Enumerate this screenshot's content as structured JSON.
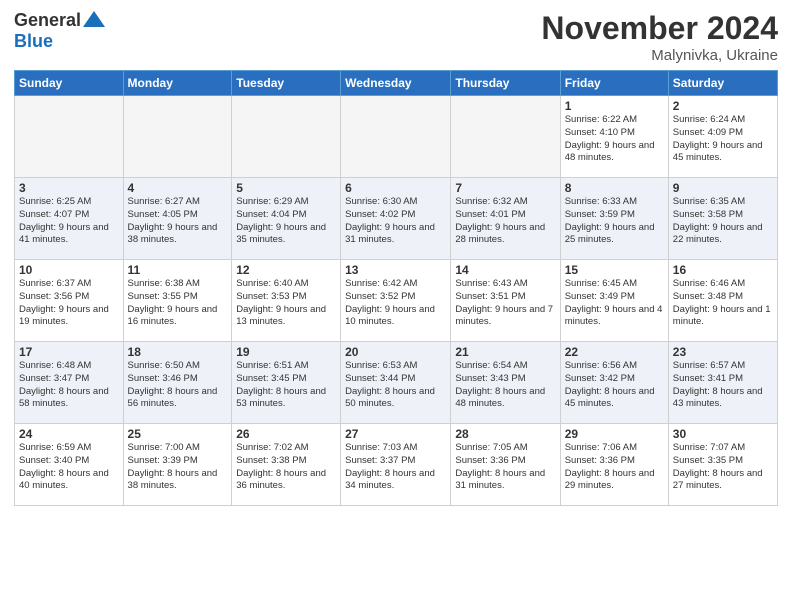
{
  "logo": {
    "general": "General",
    "blue": "Blue"
  },
  "title": "November 2024",
  "location": "Malynivka, Ukraine",
  "days_of_week": [
    "Sunday",
    "Monday",
    "Tuesday",
    "Wednesday",
    "Thursday",
    "Friday",
    "Saturday"
  ],
  "weeks": [
    [
      {
        "day": "",
        "empty": true
      },
      {
        "day": "",
        "empty": true
      },
      {
        "day": "",
        "empty": true
      },
      {
        "day": "",
        "empty": true
      },
      {
        "day": "",
        "empty": true
      },
      {
        "day": "1",
        "sunrise": "6:22 AM",
        "sunset": "4:10 PM",
        "daylight": "9 hours and 48 minutes."
      },
      {
        "day": "2",
        "sunrise": "6:24 AM",
        "sunset": "4:09 PM",
        "daylight": "9 hours and 45 minutes."
      }
    ],
    [
      {
        "day": "3",
        "sunrise": "6:25 AM",
        "sunset": "4:07 PM",
        "daylight": "9 hours and 41 minutes."
      },
      {
        "day": "4",
        "sunrise": "6:27 AM",
        "sunset": "4:05 PM",
        "daylight": "9 hours and 38 minutes."
      },
      {
        "day": "5",
        "sunrise": "6:29 AM",
        "sunset": "4:04 PM",
        "daylight": "9 hours and 35 minutes."
      },
      {
        "day": "6",
        "sunrise": "6:30 AM",
        "sunset": "4:02 PM",
        "daylight": "9 hours and 31 minutes."
      },
      {
        "day": "7",
        "sunrise": "6:32 AM",
        "sunset": "4:01 PM",
        "daylight": "9 hours and 28 minutes."
      },
      {
        "day": "8",
        "sunrise": "6:33 AM",
        "sunset": "3:59 PM",
        "daylight": "9 hours and 25 minutes."
      },
      {
        "day": "9",
        "sunrise": "6:35 AM",
        "sunset": "3:58 PM",
        "daylight": "9 hours and 22 minutes."
      }
    ],
    [
      {
        "day": "10",
        "sunrise": "6:37 AM",
        "sunset": "3:56 PM",
        "daylight": "9 hours and 19 minutes."
      },
      {
        "day": "11",
        "sunrise": "6:38 AM",
        "sunset": "3:55 PM",
        "daylight": "9 hours and 16 minutes."
      },
      {
        "day": "12",
        "sunrise": "6:40 AM",
        "sunset": "3:53 PM",
        "daylight": "9 hours and 13 minutes."
      },
      {
        "day": "13",
        "sunrise": "6:42 AM",
        "sunset": "3:52 PM",
        "daylight": "9 hours and 10 minutes."
      },
      {
        "day": "14",
        "sunrise": "6:43 AM",
        "sunset": "3:51 PM",
        "daylight": "9 hours and 7 minutes."
      },
      {
        "day": "15",
        "sunrise": "6:45 AM",
        "sunset": "3:49 PM",
        "daylight": "9 hours and 4 minutes."
      },
      {
        "day": "16",
        "sunrise": "6:46 AM",
        "sunset": "3:48 PM",
        "daylight": "9 hours and 1 minute."
      }
    ],
    [
      {
        "day": "17",
        "sunrise": "6:48 AM",
        "sunset": "3:47 PM",
        "daylight": "8 hours and 58 minutes."
      },
      {
        "day": "18",
        "sunrise": "6:50 AM",
        "sunset": "3:46 PM",
        "daylight": "8 hours and 56 minutes."
      },
      {
        "day": "19",
        "sunrise": "6:51 AM",
        "sunset": "3:45 PM",
        "daylight": "8 hours and 53 minutes."
      },
      {
        "day": "20",
        "sunrise": "6:53 AM",
        "sunset": "3:44 PM",
        "daylight": "8 hours and 50 minutes."
      },
      {
        "day": "21",
        "sunrise": "6:54 AM",
        "sunset": "3:43 PM",
        "daylight": "8 hours and 48 minutes."
      },
      {
        "day": "22",
        "sunrise": "6:56 AM",
        "sunset": "3:42 PM",
        "daylight": "8 hours and 45 minutes."
      },
      {
        "day": "23",
        "sunrise": "6:57 AM",
        "sunset": "3:41 PM",
        "daylight": "8 hours and 43 minutes."
      }
    ],
    [
      {
        "day": "24",
        "sunrise": "6:59 AM",
        "sunset": "3:40 PM",
        "daylight": "8 hours and 40 minutes."
      },
      {
        "day": "25",
        "sunrise": "7:00 AM",
        "sunset": "3:39 PM",
        "daylight": "8 hours and 38 minutes."
      },
      {
        "day": "26",
        "sunrise": "7:02 AM",
        "sunset": "3:38 PM",
        "daylight": "8 hours and 36 minutes."
      },
      {
        "day": "27",
        "sunrise": "7:03 AM",
        "sunset": "3:37 PM",
        "daylight": "8 hours and 34 minutes."
      },
      {
        "day": "28",
        "sunrise": "7:05 AM",
        "sunset": "3:36 PM",
        "daylight": "8 hours and 31 minutes."
      },
      {
        "day": "29",
        "sunrise": "7:06 AM",
        "sunset": "3:36 PM",
        "daylight": "8 hours and 29 minutes."
      },
      {
        "day": "30",
        "sunrise": "7:07 AM",
        "sunset": "3:35 PM",
        "daylight": "8 hours and 27 minutes."
      }
    ]
  ],
  "labels": {
    "sunrise": "Sunrise:",
    "sunset": "Sunset:",
    "daylight": "Daylight:"
  }
}
